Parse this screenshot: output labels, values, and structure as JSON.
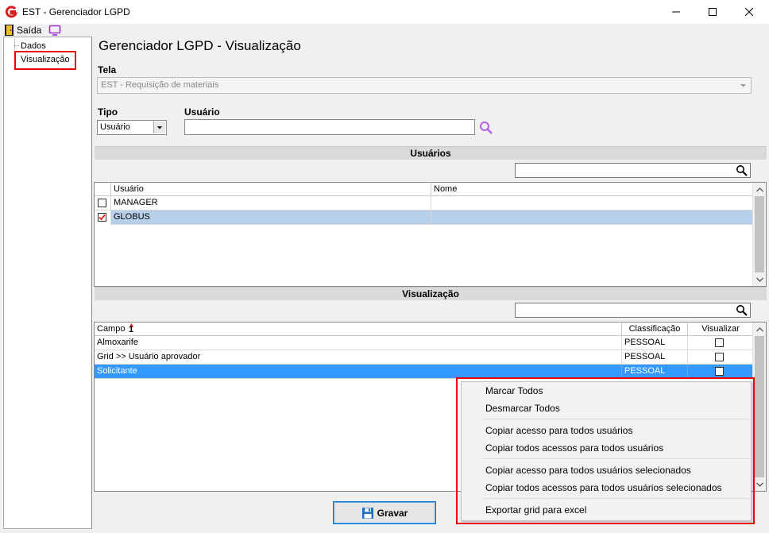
{
  "window": {
    "title": "EST - Gerenciador LGPD",
    "minimize": "—",
    "maximize": "☐",
    "close": "✕"
  },
  "menu": {
    "saida": "Saída"
  },
  "tree": {
    "items": [
      {
        "label": "Dados"
      },
      {
        "label": "Visualização"
      }
    ]
  },
  "page": {
    "title": "Gerenciador LGPD - Visualização"
  },
  "form": {
    "tela_label": "Tela",
    "tela_value": "EST - Requisição de materiais",
    "tipo_label": "Tipo",
    "tipo_value": "Usuário",
    "usuario_label": "Usuário",
    "usuario_value": ""
  },
  "usuarios_section": {
    "title": "Usuários",
    "columns": [
      "Usuário",
      "Nome"
    ],
    "rows": [
      {
        "usuario": "MANAGER",
        "nome": "",
        "checked": false
      },
      {
        "usuario": "GLOBUS",
        "nome": "",
        "checked": true
      }
    ]
  },
  "visualizacao_section": {
    "title": "Visualização",
    "columns": [
      "Campo",
      "Classificação",
      "Visualizar"
    ],
    "sort_indicator": "1",
    "rows": [
      {
        "campo": "Almoxarife",
        "classificacao": "PESSOAL",
        "visualizar": false
      },
      {
        "campo": "Grid >> Usuário aprovador",
        "classificacao": "PESSOAL",
        "visualizar": false
      },
      {
        "campo": "Solicitante",
        "classificacao": "PESSOAL",
        "visualizar": false
      }
    ]
  },
  "context_menu": {
    "items": [
      "Marcar Todos",
      "Desmarcar Todos",
      "Copiar acesso para todos usuários",
      "Copiar todos acessos para todos usuários",
      "Copiar acesso para todos usuários selecionados",
      "Copiar todos acessos para todos usuários selecionados",
      "Exportar grid para excel"
    ]
  },
  "footer": {
    "gravar_label": "Gravar"
  },
  "colors": {
    "selection": "#3399ff",
    "highlight_border": "#ee0000",
    "row_highlight": "#b7cfe9",
    "monitor_icon": "#9b30d0",
    "search_icon": "#b060e0"
  },
  "icons": {
    "app": "globus-g-icon",
    "saida": "exit-door-icon",
    "monitor": "monitor-icon",
    "search": "magnifier-icon",
    "save": "floppy-disk-icon"
  }
}
